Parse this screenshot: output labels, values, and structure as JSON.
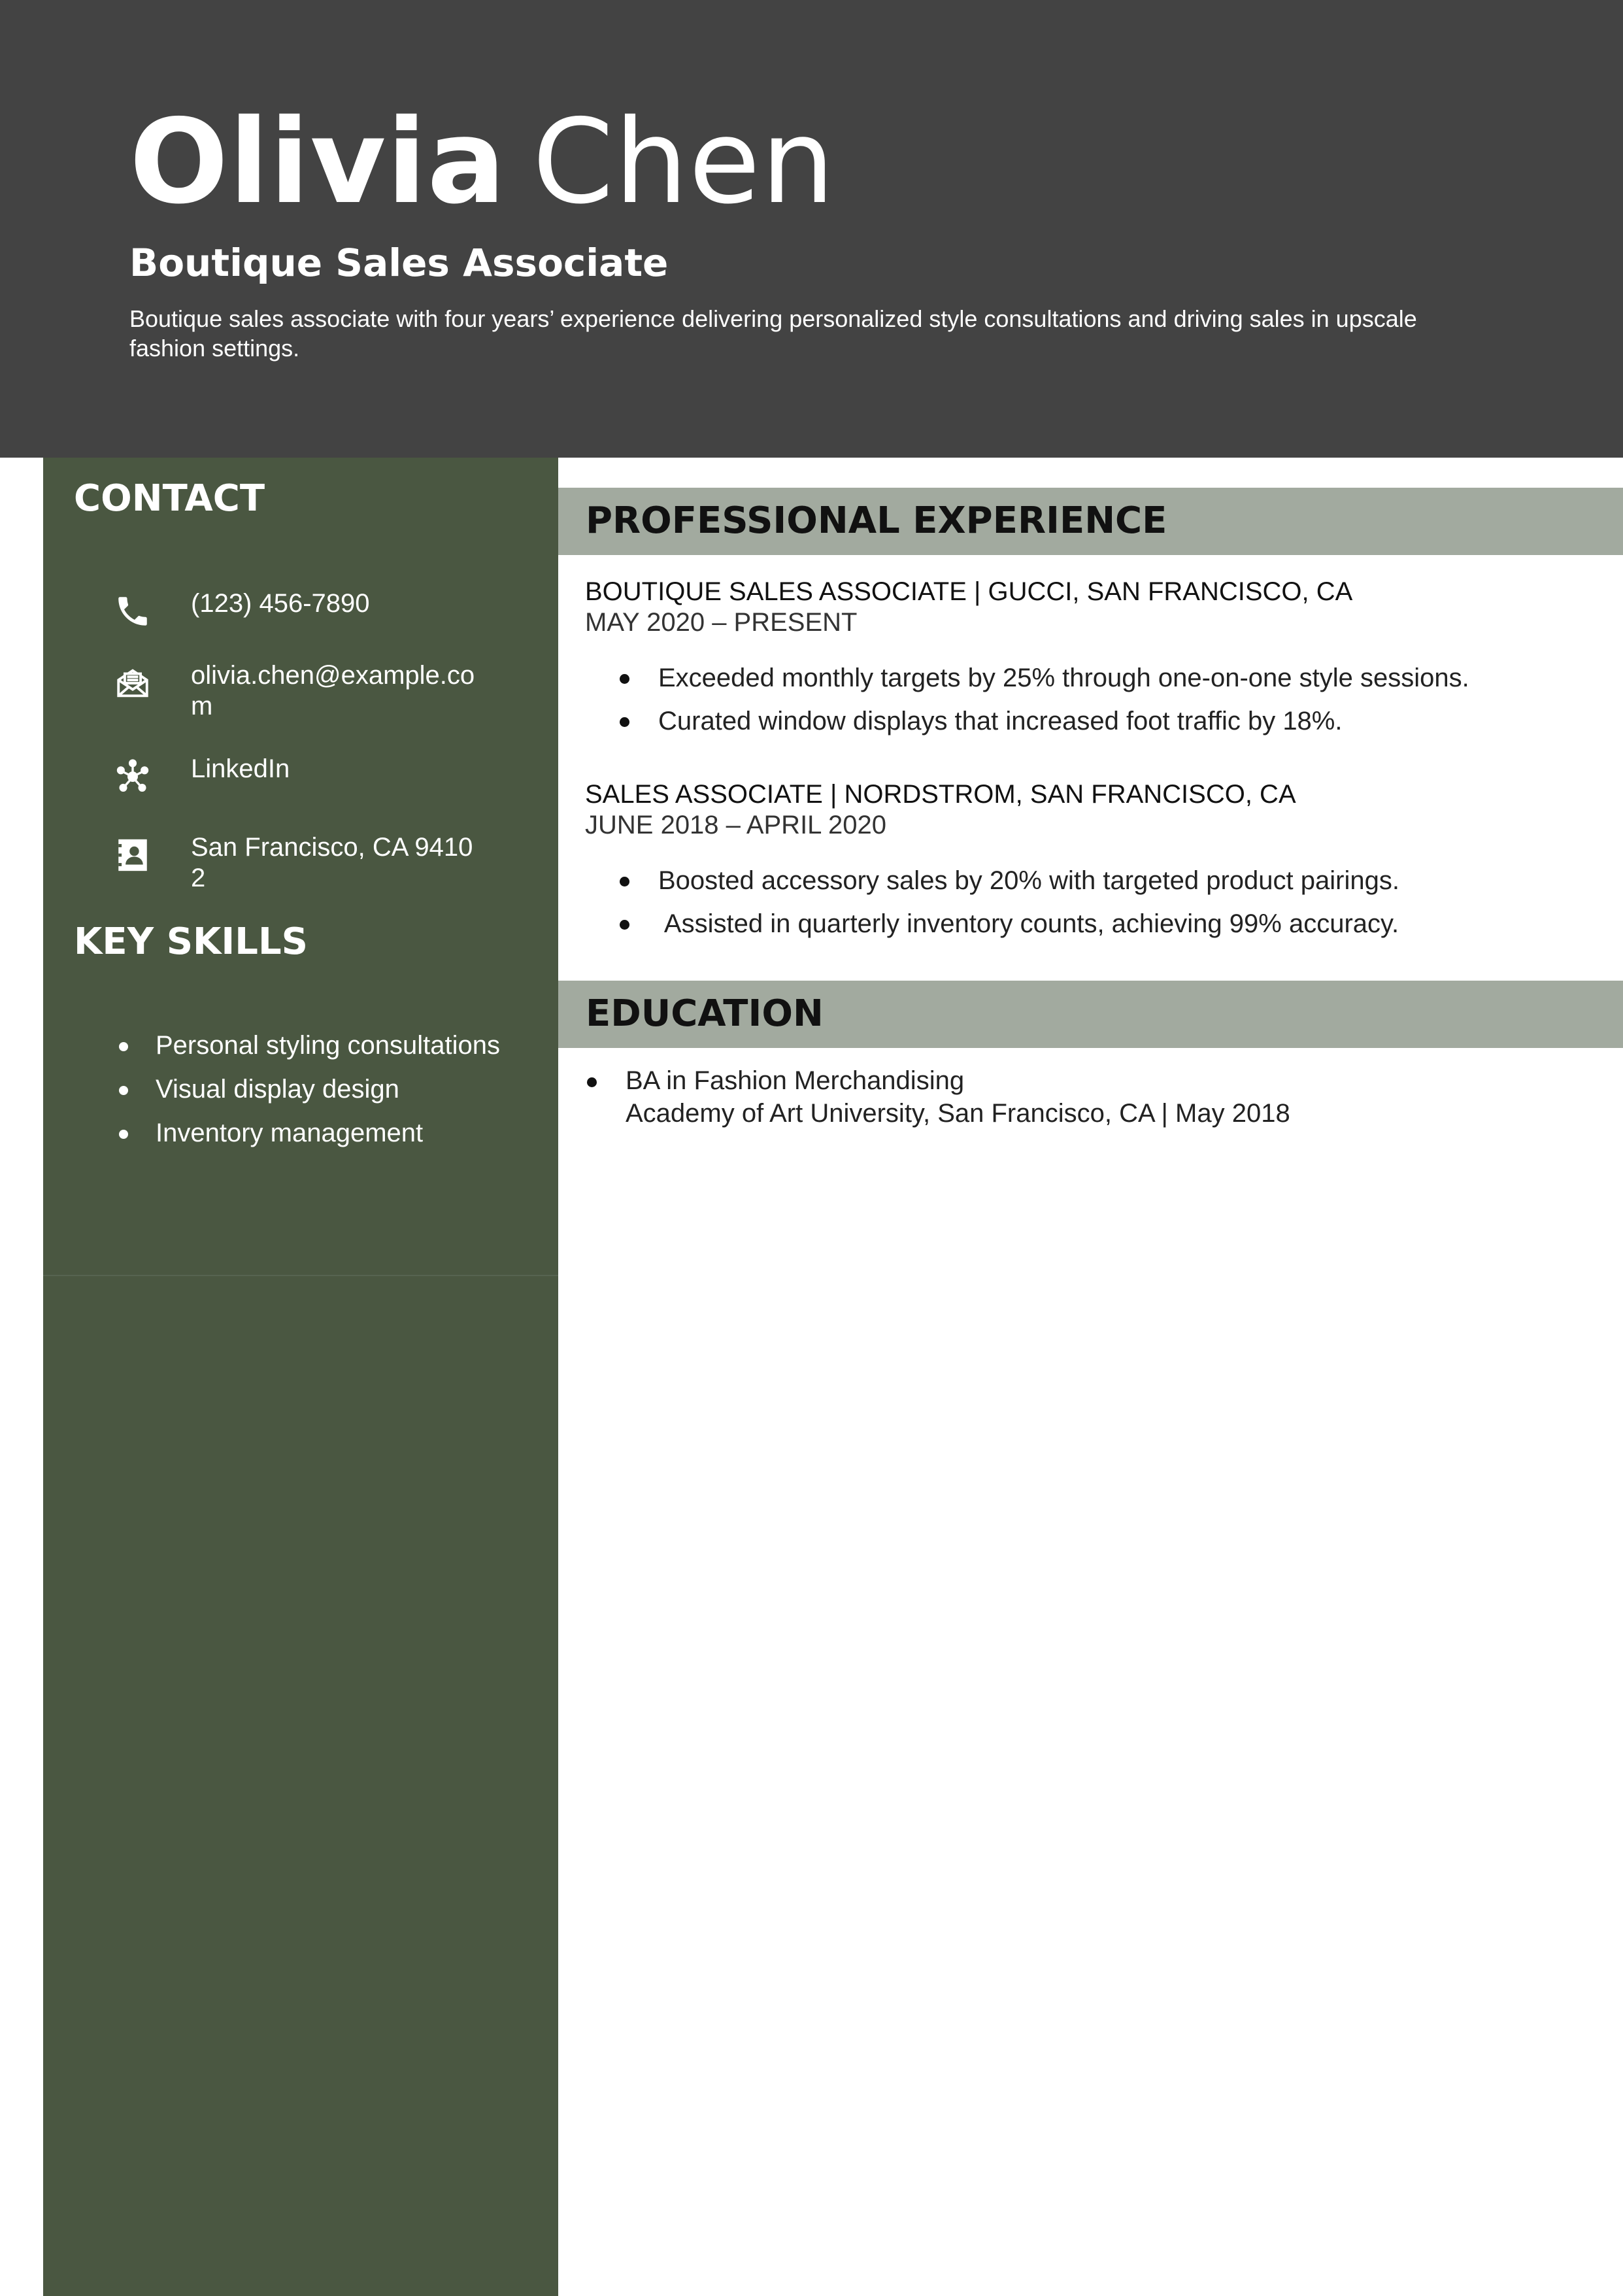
{
  "header": {
    "first_name": "Olivia",
    "last_name": "Chen",
    "title": "Boutique Sales Associate",
    "summary": "Boutique sales associate with four years’ experience delivering personalized style consultations and driving sales in upscale fashion settings."
  },
  "sidebar": {
    "contact_heading": "CONTACT",
    "contact": [
      {
        "icon": "phone-icon",
        "text": "(123) 456-7890"
      },
      {
        "icon": "envelope-icon",
        "text": "olivia.chen@example.com"
      },
      {
        "icon": "network-icon",
        "text": "LinkedIn"
      },
      {
        "icon": "address-book-icon",
        "text": "San Francisco, CA 94102"
      }
    ],
    "skills_heading": "KEY SKILLS",
    "skills": [
      "Personal styling consultations",
      "Visual display design",
      "Inventory management"
    ]
  },
  "experience": {
    "heading": "PROFESSIONAL EXPERIENCE",
    "jobs": [
      {
        "role": "BOUTIQUE SALES ASSOCIATE | GUCCI, SAN FRANCISCO, CA",
        "dates": "MAY 2020 – PRESENT",
        "bullets": [
          "Exceeded monthly targets by 25% through one-on-one style sessions.",
          "Curated window displays that increased foot traffic by 18%."
        ]
      },
      {
        "role": "SALES ASSOCIATE | NORDSTROM, SAN FRANCISCO, CA",
        "dates": "JUNE 2018 – APRIL 2020",
        "bullets": [
          "Boosted accessory sales by 20% with targeted product pairings.",
          " Assisted in quarterly inventory counts, achieving 99% accuracy."
        ]
      }
    ]
  },
  "education": {
    "heading": "EDUCATION",
    "items": [
      {
        "degree": "BA in Fashion Merchandising",
        "school": "Academy of Art University, San Francisco, CA | May 2018"
      }
    ]
  },
  "colors": {
    "header_bg": "#434343",
    "sidebar_bg": "#4a5741",
    "section_bar_bg": "#a2aa9f"
  }
}
